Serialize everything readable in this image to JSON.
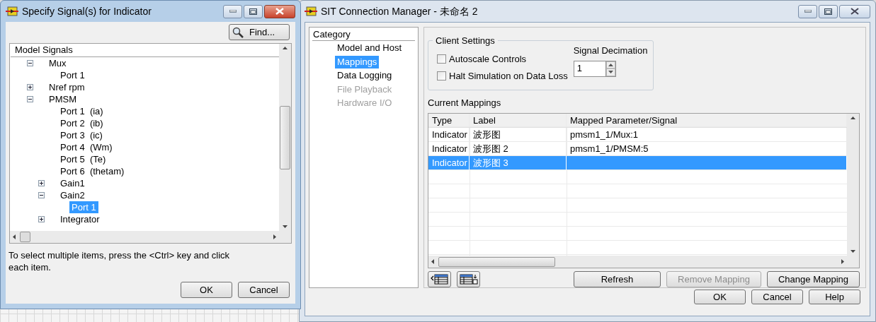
{
  "signal_dialog": {
    "title": "Specify Signal(s) for Indicator",
    "find_button": "Find...",
    "tree": {
      "header": "Model Signals",
      "items": [
        {
          "label": "Mux",
          "expanded": true,
          "selected": false,
          "children": [
            {
              "label": "Port 1",
              "selected": false
            }
          ]
        },
        {
          "label": "Nref rpm",
          "expanded": false,
          "selected": false
        },
        {
          "label": "PMSM",
          "expanded": true,
          "selected": false,
          "children": [
            {
              "label": "Port 1  (ia)",
              "selected": false
            },
            {
              "label": "Port 2  (ib)",
              "selected": false
            },
            {
              "label": "Port 3  (ic)",
              "selected": false
            },
            {
              "label": "Port 4  (Wm)",
              "selected": false
            },
            {
              "label": "Port 5  (Te)",
              "selected": false
            },
            {
              "label": "Port 6  (thetam)",
              "selected": false
            },
            {
              "label": "Gain1",
              "expanded": false,
              "selected": false
            },
            {
              "label": "Gain2",
              "expanded": true,
              "selected": false,
              "children": [
                {
                  "label": "Port 1",
                  "selected": true
                }
              ]
            },
            {
              "label": "Integrator",
              "expanded": false,
              "selected": false
            }
          ]
        }
      ]
    },
    "hint": "To select multiple items, press the <Ctrl> key and click each item.",
    "buttons": [
      "OK",
      "Cancel"
    ]
  },
  "connection_manager": {
    "title": "SIT Connection Manager - 未命名 2",
    "category": {
      "header": "Category",
      "items": [
        {
          "label": "Model and Host",
          "selected": false,
          "disabled": false
        },
        {
          "label": "Mappings",
          "selected": true,
          "disabled": false
        },
        {
          "label": "Data Logging",
          "selected": false,
          "disabled": false
        },
        {
          "label": "File Playback",
          "selected": false,
          "disabled": true
        },
        {
          "label": "Hardware I/O",
          "selected": false,
          "disabled": true
        }
      ]
    },
    "client_settings": {
      "title": "Client Settings",
      "checkboxes": [
        {
          "label": "Autoscale Controls",
          "checked": false
        },
        {
          "label": "Halt Simulation on Data Loss",
          "checked": false
        }
      ],
      "decimation": {
        "label": "Signal Decimation",
        "value": "1"
      }
    },
    "mappings": {
      "title": "Current Mappings",
      "columns": [
        "Type",
        "Label",
        "Mapped Parameter/Signal"
      ],
      "rows": [
        {
          "cells": [
            "Indicator",
            "波形图",
            "pmsm1_1/Mux:1"
          ],
          "selected": false
        },
        {
          "cells": [
            "Indicator",
            "波形图 2",
            "pmsm1_1/PMSM:5"
          ],
          "selected": false
        },
        {
          "cells": [
            "Indicator",
            "波形图 3",
            ""
          ],
          "selected": true
        }
      ]
    },
    "actions": [
      {
        "label": "Refresh",
        "disabled": false
      },
      {
        "label": "Remove Mapping",
        "disabled": true
      },
      {
        "label": "Change Mapping",
        "disabled": false
      }
    ],
    "buttons": [
      "OK",
      "Cancel",
      "Help"
    ]
  }
}
